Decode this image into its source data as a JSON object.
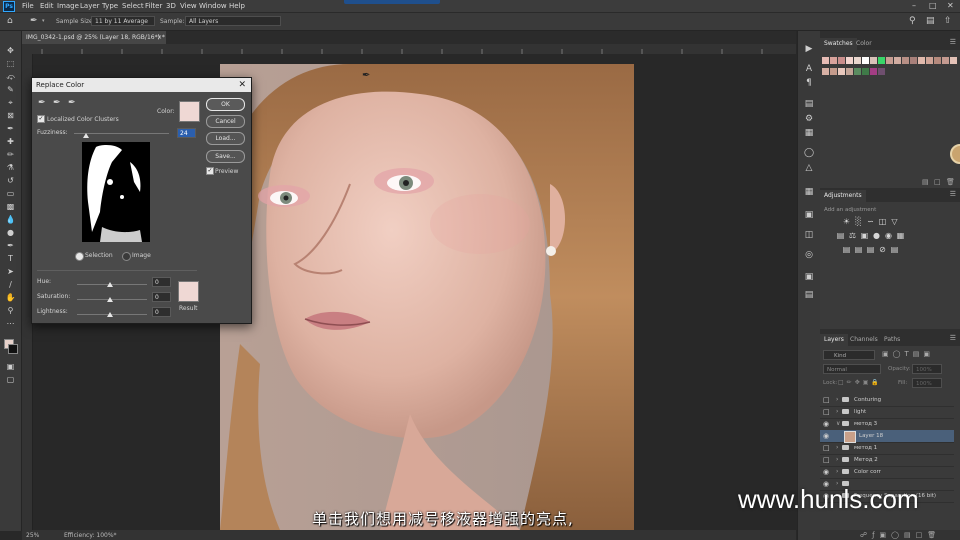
{
  "menu": {
    "logo": "Ps",
    "items": [
      "File",
      "Edit",
      "Image",
      "Layer",
      "Type",
      "Select",
      "Filter",
      "3D",
      "View",
      "Window",
      "Help"
    ]
  },
  "options": {
    "sample_size_label": "Sample Size:",
    "sample_size_value": "11 by 11 Average",
    "sample_label": "Sample:",
    "sample_value": "All Layers"
  },
  "document": {
    "tab_title": "IMG_0342-1.psd @ 25% (Layer 18, RGB/16*) *",
    "zoom": "25%",
    "efficiency": "Efficiency: 100%*"
  },
  "dialog": {
    "title": "Replace Color",
    "localized_label": "Localized Color Clusters",
    "color_label": "Color:",
    "fuzziness_label": "Fuzziness:",
    "fuzziness_value": "24",
    "selection_label": "Selection",
    "image_label": "Image",
    "hue_label": "Hue:",
    "hue_value": "0",
    "saturation_label": "Saturation:",
    "saturation_value": "0",
    "lightness_label": "Lightness:",
    "lightness_value": "0",
    "result_label": "Result",
    "ok": "OK",
    "cancel": "Cancel",
    "load": "Load...",
    "save": "Save...",
    "preview": "Preview",
    "sample_color": "#efd8d4",
    "result_color": "#efd8d4"
  },
  "swatches_panel": {
    "tabs": [
      "Swatches",
      "Color"
    ],
    "colors": [
      "#e7bcb5",
      "#d9a39c",
      "#c98e8c",
      "#f3d5cf",
      "#ead7cf",
      "#ffffff",
      "#d9c2b9",
      "#39d669",
      "#c89e93",
      "#d2ada2",
      "#b89086",
      "#a8807a",
      "#e0b9ac",
      "#cfa497",
      "#b58a7d",
      "#c49a90",
      "#e4c2b7",
      "#d7b0a4",
      "#c59b8c",
      "#e8c8bd",
      "#c3a497",
      "#5a8c60",
      "#3f7a48",
      "#a33d84",
      "#6f4f6f"
    ]
  },
  "adjustments_panel": {
    "title": "Adjustments",
    "subtitle": "Add an adjustment"
  },
  "layers_panel": {
    "tabs": [
      "Layers",
      "Channels",
      "Paths"
    ],
    "kind": "Kind",
    "blend_mode": "Normal",
    "opacity_label": "Opacity:",
    "opacity_value": "100%",
    "lock_label": "Lock:",
    "fill_label": "Fill:",
    "fill_value": "100%",
    "layers": [
      {
        "name": "Conturing",
        "type": "group",
        "visible": false
      },
      {
        "name": "light",
        "type": "group",
        "visible": false
      },
      {
        "name": "метод 3",
        "type": "group",
        "visible": true,
        "expanded": true
      },
      {
        "name": "Layer 18",
        "type": "layer",
        "visible": true,
        "selected": true
      },
      {
        "name": "метод 1",
        "type": "group",
        "visible": false
      },
      {
        "name": "Метод 2",
        "type": "group",
        "visible": false
      },
      {
        "name": "Color corr",
        "type": "group",
        "visible": true
      },
      {
        "name": "",
        "type": "group",
        "visible": true
      },
      {
        "name": "Frequency Separation (16 bit)",
        "type": "group",
        "visible": true
      }
    ]
  },
  "overlay": {
    "subtitle": "单击我们想用减号移液器增强的亮点,",
    "watermark": "www.hunls.com"
  }
}
